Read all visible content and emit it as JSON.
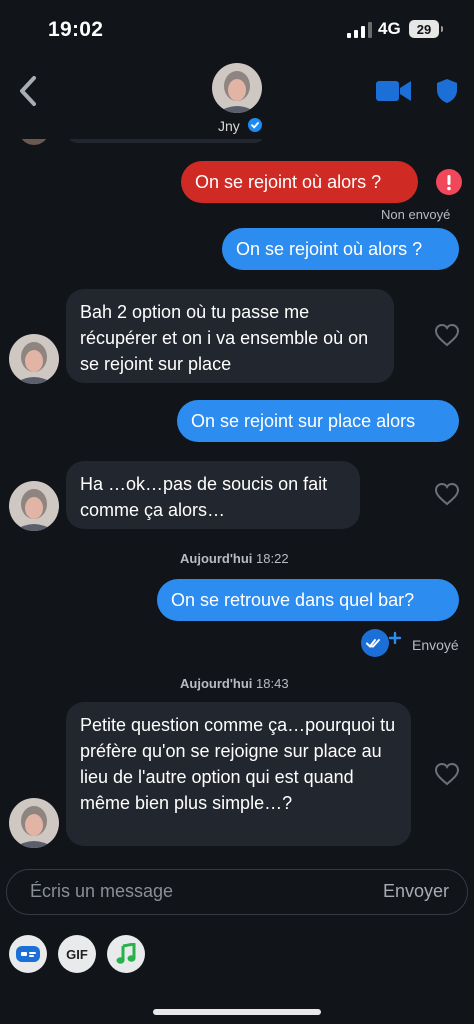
{
  "status_bar": {
    "time": "19:02",
    "network": "4G",
    "battery": "29"
  },
  "header": {
    "name": "Jny"
  },
  "messages": {
    "m1_text": "On se rejoint où alors ?",
    "m1_status": "Non envoyé",
    "m2_text": "On se rejoint où alors ?",
    "m3_text": "Bah 2 option où tu passe me récupérer et on i va ensemble où on se rejoint sur place",
    "m4_text": "On se rejoint sur place alors",
    "m5_text": "Ha …ok…pas de soucis on fait comme ça alors…",
    "day1_label": "Aujourd'hui",
    "day1_time": "18:22",
    "m6_text": "On se retrouve dans quel bar?",
    "m6_status": "Envoyé",
    "day2_label": "Aujourd'hui",
    "day2_time": "18:43",
    "m7_text": "Petite question comme ça…pourquoi tu préfère qu'on se rejoigne sur place au lieu de l'autre option qui est quand même bien plus simple…?"
  },
  "composer": {
    "placeholder": "Écris un message",
    "send_label": "Envoyer"
  },
  "actions": {
    "gif_label": "GIF"
  },
  "colors": {
    "background": "#111419",
    "outgoing": "#2d8cf0",
    "failed": "#d02a25",
    "incoming": "#22262e",
    "accent": "#1d6fd8"
  }
}
